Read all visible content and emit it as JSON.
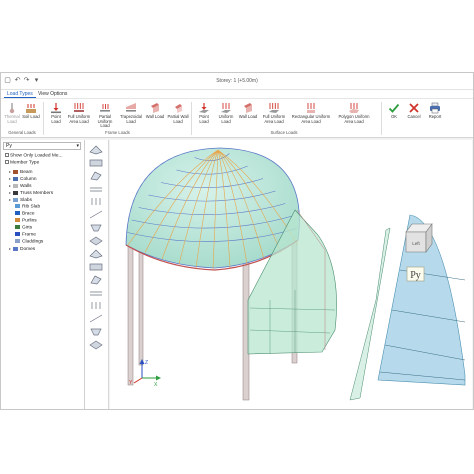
{
  "titlebar": {
    "title": "Storey: 1 (+5.00m)"
  },
  "tabs": [
    "Load Types",
    "View Options"
  ],
  "ribbon": {
    "general_loads": {
      "label": "General Loads",
      "buttons": [
        {
          "label": "Thermal Load",
          "icon": "thermal-icon",
          "enabled": false
        },
        {
          "label": "Soil Load",
          "icon": "soil-icon",
          "enabled": true
        }
      ]
    },
    "frame_loads": {
      "label": "Frame Loads",
      "buttons": [
        {
          "label": "Point Load",
          "icon": "point-load-icon"
        },
        {
          "label": "Full Uniform Area Load",
          "icon": "full-uniform-icon"
        },
        {
          "label": "Partial Uniform Load",
          "icon": "partial-uniform-icon"
        },
        {
          "label": "Trapezoidal Load",
          "icon": "trapezoidal-icon"
        },
        {
          "label": "Wall Load",
          "icon": "wall-load-icon"
        },
        {
          "label": "Partial Wall Load",
          "icon": "partial-wall-icon"
        }
      ]
    },
    "surface_loads": {
      "label": "Surface Loads",
      "buttons": [
        {
          "label": "Point Load",
          "icon": "point-load-icon"
        },
        {
          "label": "Uniform Load",
          "icon": "uniform-load-icon"
        },
        {
          "label": "Wall Load",
          "icon": "wall-load-icon"
        },
        {
          "label": "Full Uniform Area Load",
          "icon": "full-uniform-icon"
        },
        {
          "label": "Rectangular Uniform Area Load",
          "icon": "rect-uniform-icon"
        },
        {
          "label": "Polygon Uniform Area Load",
          "icon": "polygon-uniform-icon"
        }
      ]
    },
    "actions": [
      {
        "label": "OK",
        "icon": "check-icon"
      },
      {
        "label": "Cancel",
        "icon": "close-icon"
      },
      {
        "label": "Report",
        "icon": "printer-icon"
      }
    ]
  },
  "left_panel": {
    "combo_value": "Py",
    "show_only_loaded": "Show Only Loaded Me...",
    "member_type": "Member Type",
    "tree": [
      "Beam",
      "Column",
      "Walls",
      "Truss Members",
      "Slabs",
      "Rib Slab",
      "Brace",
      "Purlins",
      "Girts",
      "Frame",
      "Claddings",
      "Domes"
    ]
  },
  "viewport": {
    "view_cube_face": "Left",
    "load_label": "Py",
    "axes": {
      "x": "X",
      "y": "Y",
      "z": "Z"
    }
  },
  "colors": {
    "accent": "#1f5fbf",
    "ok_green": "#2e9e3e",
    "cancel_red": "#d0342c",
    "load_fill": "#9fd8c4",
    "dome_stroke": "#5a78c8"
  }
}
